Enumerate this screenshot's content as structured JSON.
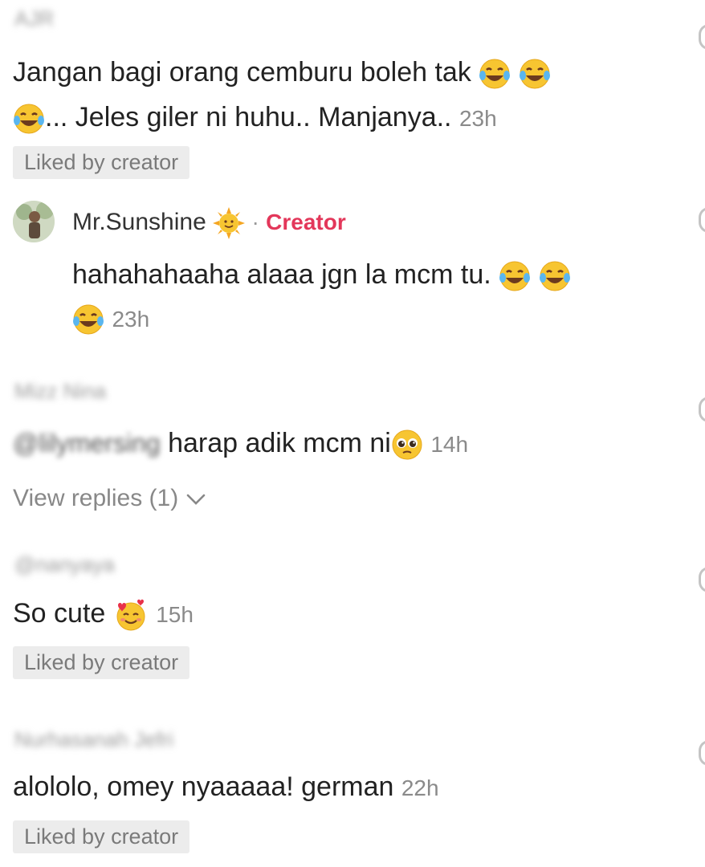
{
  "comments": [
    {
      "username": "AJR",
      "text": "Jangan bagi orang cemburu boleh tak",
      "text_line2": "... Jeles giler ni huhu.. Manjanya..",
      "time": "23h",
      "liked_badge": "Liked by creator",
      "emoji": "face-with-tears-of-joy"
    },
    {
      "username": "Mr.Sunshine",
      "creator_label": "Creator",
      "separator": "·",
      "text": "hahahahaaha alaaa jgn la mcm tu.",
      "time": "23h",
      "emoji": "sun-with-face"
    },
    {
      "username": "Mizz Nina",
      "mention": "@lilymersing",
      "text": "harap adik mcm ni",
      "time": "14h",
      "view_replies": "View replies (1)",
      "emoji": "pleading-face"
    },
    {
      "username": "@nanyaya",
      "text": "So cute",
      "time": "15h",
      "liked_badge": "Liked by creator",
      "emoji": "smiling-face-with-hearts"
    },
    {
      "username": "Nurhasanah Jefri",
      "text": "alololo, omey nyaaaaa! german",
      "time": "22h",
      "liked_badge": "Liked by creator"
    }
  ],
  "colors": {
    "creator_accent": "#e3375a",
    "badge_bg": "#ececec",
    "muted_text": "#8a8a8a"
  }
}
